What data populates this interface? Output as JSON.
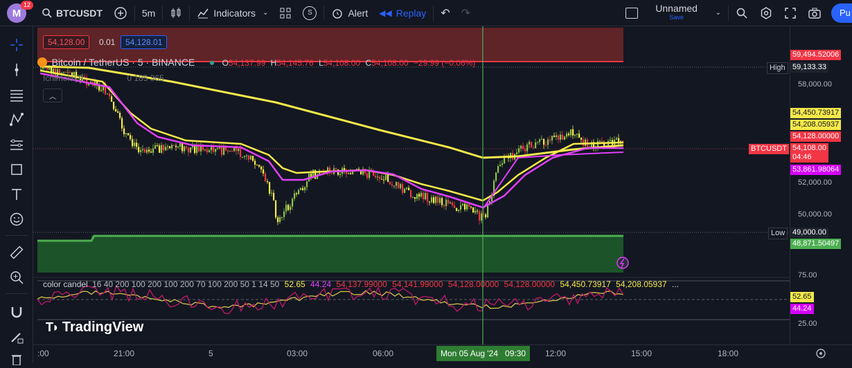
{
  "topbar": {
    "avatar_letter": "M",
    "notifications": "12",
    "symbol": "BTCUSDT",
    "interval": "5m",
    "indicators_label": "Indicators",
    "alert_label": "Alert",
    "replay_label": "Replay",
    "layout_name": "Unnamed",
    "layout_status": "Save",
    "publish_label": "Pu"
  },
  "orderbar": {
    "sell_price": "54,128.00",
    "qty": "0.01",
    "buy_price": "54,128.01"
  },
  "legend": {
    "title": "Bitcoin / TetherUS · 5 · BINANCE",
    "o_label": "O",
    "o": "54,137.99",
    "h_label": "H",
    "h": "54,145.76",
    "l_label": "L",
    "l": "54,108.00",
    "c_label": "C",
    "c": "54,108.00",
    "change": "−29.99 (−0.06%)",
    "ichimoku": "Ichimoku 9",
    "ichimoku_tail": "0 185 365"
  },
  "price_scale": {
    "levels": [
      "58,000.00",
      "52,000.00",
      "50,000.00"
    ],
    "top_red": "59,494.52006",
    "high_label": "High",
    "high": "59,133.33",
    "y1": "54,450.73917",
    "y2": "54,208.05937",
    "red2": "54,128.00000",
    "symbol_tag": "BTCUSDT",
    "current": "54,108.00",
    "countdown": "04:46",
    "magenta": "53,861.98064",
    "low_label": "Low",
    "low": "49,000.00",
    "green": "48,871.50497",
    "osc_top": "75.00",
    "osc_y": "52.65",
    "osc_m": "44.24",
    "osc_bottom": "25.00"
  },
  "oscillator": {
    "name": "color candel",
    "params": "16 40 200 100 200 100 200 70 100 200 50 1 14 50",
    "v1": "52.65",
    "v2": "44.24",
    "v3": "54,137.99000",
    "v4": "54,141.99000",
    "v5": "54,128.00000",
    "v6": "54,128.00000",
    "v7": "54,450.73917",
    "v8": "54,208.05937",
    "more": "..."
  },
  "time_axis": {
    "labels": [
      ":00",
      "21:00",
      "5",
      "03:00",
      "06:00",
      "12:00",
      "15:00",
      "18:00"
    ],
    "crosshair": "Mon 05 Aug '24   09:30"
  },
  "watermark": "TradingView",
  "colors": {
    "bg": "#131722",
    "up": "#8bc34a",
    "down": "#f23645",
    "yellow": "#f5e94a",
    "magenta": "#e040fb",
    "green_zone": "#2e7d32",
    "red_zone": "#a52a2a",
    "crosshair": "#4caf50"
  }
}
